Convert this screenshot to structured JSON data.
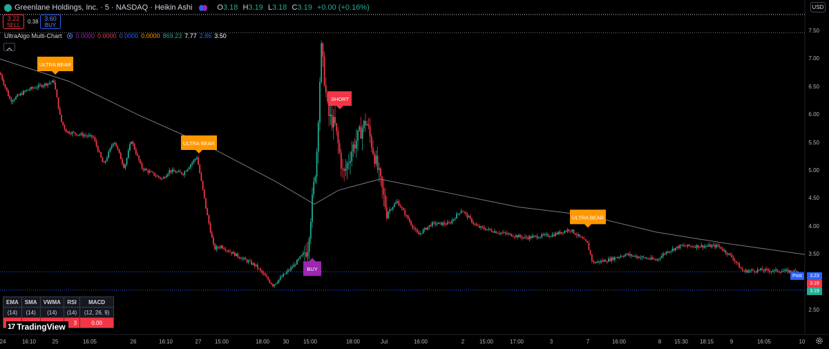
{
  "header": {
    "symbol": "Greenlane Holdings, Inc. · 5 · NASDAQ · Heikin Ashi",
    "ohlc": [
      {
        "k": "O",
        "v": "3.18"
      },
      {
        "k": "H",
        "v": "3.19"
      },
      {
        "k": "L",
        "v": "3.18"
      },
      {
        "k": "C",
        "v": "3.19"
      },
      {
        "k": "",
        "v": "+0.00 (+0.16%)"
      }
    ],
    "currency": "USD"
  },
  "trade": {
    "sell_price": "3.22",
    "sell_label": "SELL",
    "spread": "0.38",
    "buy_price": "3.60",
    "buy_label": "BUY"
  },
  "indicator": {
    "name": "UltraAlgo Multi-Chart",
    "values": [
      {
        "v": "0.0000",
        "color": "#9c27b0"
      },
      {
        "v": "0.0000",
        "color": "#f23645"
      },
      {
        "v": "0.0000",
        "color": "#2962ff"
      },
      {
        "v": "0.0000",
        "color": "#ff9800"
      },
      {
        "v": "869.23",
        "color": "#22ab94"
      },
      {
        "v": "7.77",
        "color": "#ffffff"
      },
      {
        "v": "2.86",
        "color": "#2962ff"
      },
      {
        "v": "3.50",
        "color": "#ffffff"
      }
    ]
  },
  "price_axis": {
    "ticks": [
      "7.50",
      "7.00",
      "6.50",
      "6.00",
      "5.50",
      "5.00",
      "4.50",
      "4.00",
      "3.50",
      "3.00",
      "2.50"
    ],
    "post_label": "Post",
    "post_price": "3.23",
    "last_price_1": "3.19",
    "last_price_2": "3.19"
  },
  "time_axis": {
    "labels": [
      "24",
      "16:10",
      "25",
      "16:05",
      "26",
      "16:10",
      "27",
      "15:00",
      "18:00",
      "30",
      "15:00",
      "18:00",
      "Jul",
      "16:00",
      "2",
      "15:00",
      "17:00",
      "3",
      "7",
      "16:00",
      "8",
      "15:30",
      "18:15",
      "9",
      "16:05",
      "10"
    ]
  },
  "signals": [
    {
      "text": "ULTRA BEAR",
      "kind": "bear"
    },
    {
      "text": "ULTRA BEAR",
      "kind": "bear"
    },
    {
      "text": "SHORT",
      "kind": "short"
    },
    {
      "text": "BUY",
      "kind": "buy"
    },
    {
      "text": "ULTRA BEAR",
      "kind": "bear"
    }
  ],
  "table": {
    "headers": [
      "EMA",
      "SMA",
      "VWMA",
      "RSI",
      "MACD"
    ],
    "params": [
      "(14)",
      "(14)",
      "(14)",
      "(14)",
      "(12, 26, 9)"
    ],
    "values": [
      "",
      "",
      "",
      "3",
      "0.00"
    ]
  },
  "branding": {
    "name": "TradingView"
  },
  "colors": {
    "up": "#22ab94",
    "down": "#f23645",
    "bear": "#ff9800",
    "short": "#f23645",
    "buy": "#9c27b0",
    "ma_line": "#787b86"
  },
  "chart_data": {
    "type": "candlestick",
    "ylim": [
      2.5,
      7.6
    ],
    "anchors": [
      [
        0,
        6.75
      ],
      [
        15,
        6.25
      ],
      [
        40,
        6.45
      ],
      [
        78,
        6.6
      ],
      [
        88,
        5.9
      ],
      [
        96,
        5.7
      ],
      [
        135,
        5.6
      ],
      [
        150,
        5.1
      ],
      [
        165,
        5.55
      ],
      [
        180,
        5.05
      ],
      [
        190,
        5.55
      ],
      [
        205,
        5.05
      ],
      [
        235,
        4.85
      ],
      [
        245,
        5.0
      ],
      [
        265,
        4.95
      ],
      [
        285,
        5.25
      ],
      [
        300,
        4.2
      ],
      [
        310,
        3.6
      ],
      [
        320,
        3.65
      ],
      [
        340,
        3.5
      ],
      [
        370,
        3.3
      ],
      [
        395,
        2.95
      ],
      [
        425,
        3.3
      ],
      [
        445,
        3.6
      ],
      [
        458,
        5.2
      ],
      [
        465,
        7.2
      ],
      [
        475,
        6.0
      ],
      [
        485,
        5.8
      ],
      [
        497,
        4.9
      ],
      [
        510,
        5.4
      ],
      [
        530,
        5.9
      ],
      [
        548,
        4.95
      ],
      [
        560,
        4.25
      ],
      [
        575,
        4.45
      ],
      [
        605,
        3.85
      ],
      [
        625,
        4.05
      ],
      [
        650,
        4.05
      ],
      [
        668,
        4.3
      ],
      [
        690,
        4.0
      ],
      [
        720,
        3.9
      ],
      [
        760,
        3.8
      ],
      [
        800,
        3.85
      ],
      [
        825,
        3.95
      ],
      [
        850,
        3.7
      ],
      [
        858,
        3.35
      ],
      [
        880,
        3.4
      ],
      [
        905,
        3.5
      ],
      [
        950,
        3.4
      ],
      [
        965,
        3.55
      ],
      [
        985,
        3.65
      ],
      [
        1040,
        3.65
      ],
      [
        1060,
        3.45
      ],
      [
        1075,
        3.2
      ],
      [
        1100,
        3.22
      ],
      [
        1155,
        3.19
      ]
    ],
    "moving_average": [
      [
        0,
        7.0
      ],
      [
        100,
        6.6
      ],
      [
        200,
        6.0
      ],
      [
        300,
        5.45
      ],
      [
        400,
        4.8
      ],
      [
        455,
        4.4
      ],
      [
        490,
        4.65
      ],
      [
        550,
        4.85
      ],
      [
        650,
        4.6
      ],
      [
        750,
        4.35
      ],
      [
        850,
        4.2
      ],
      [
        950,
        3.9
      ],
      [
        1050,
        3.7
      ],
      [
        1165,
        3.5
      ]
    ],
    "signal_points": [
      {
        "label": "ULTRA BEAR",
        "x": 80,
        "y": 6.72,
        "dir": "down"
      },
      {
        "label": "ULTRA BEAR",
        "x": 288,
        "y": 5.31,
        "dir": "down"
      },
      {
        "label": "SHORT",
        "x": 492,
        "y": 6.1,
        "dir": "down"
      },
      {
        "label": "BUY",
        "x": 452,
        "y": 3.5,
        "dir": "up"
      },
      {
        "label": "ULTRA BEAR",
        "x": 851,
        "y": 3.98,
        "dir": "down"
      }
    ],
    "levels": {
      "ask_dotted": 7.78,
      "high_dotted": 7.47,
      "last_dotted": 3.19,
      "bid_dotted": 2.86
    }
  }
}
